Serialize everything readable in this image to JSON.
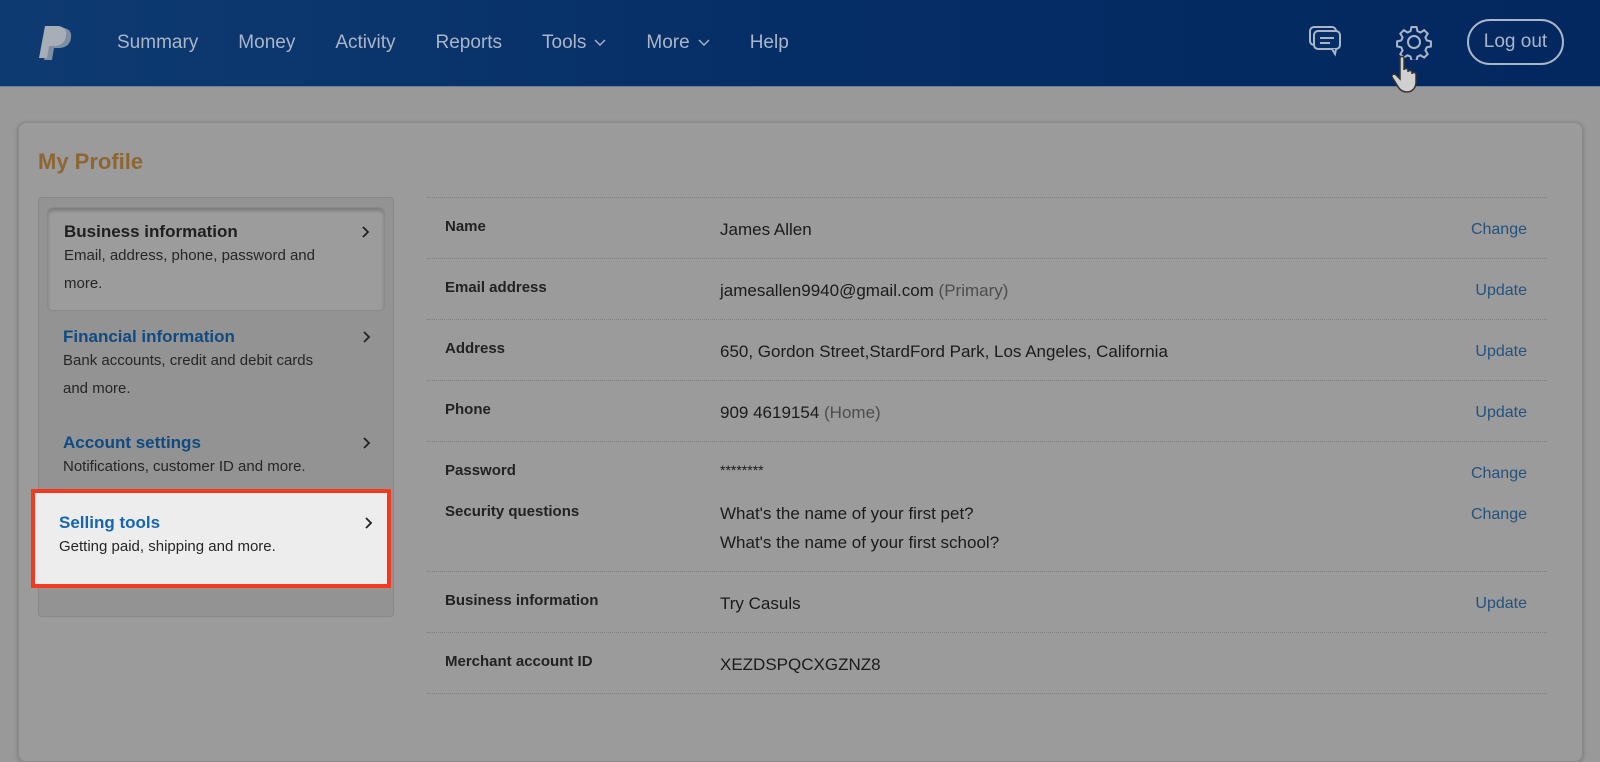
{
  "topbar": {
    "logo": "paypal-logo",
    "nav": [
      {
        "label": "Summary",
        "dropdown": false
      },
      {
        "label": "Money",
        "dropdown": false
      },
      {
        "label": "Activity",
        "dropdown": false
      },
      {
        "label": "Reports",
        "dropdown": false
      },
      {
        "label": "Tools",
        "dropdown": true
      },
      {
        "label": "More",
        "dropdown": true
      },
      {
        "label": "Help",
        "dropdown": false
      }
    ],
    "icons": [
      "messages-icon",
      "gear-icon"
    ],
    "logout_label": "Log out"
  },
  "page": {
    "title": "My Profile"
  },
  "sidebar": {
    "items": [
      {
        "title": "Business information",
        "desc": "Email, address, phone, password and more.",
        "active": true
      },
      {
        "title": "Financial information",
        "desc": "Bank accounts, credit and debit cards and more.",
        "active": false
      },
      {
        "title": "Account settings",
        "desc": "Notifications, customer ID and more.",
        "active": false
      },
      {
        "title": "Selling tools",
        "desc": "Getting paid, shipping and more.",
        "active": false,
        "highlighted": true
      }
    ]
  },
  "details": {
    "rows": [
      {
        "label": "Name",
        "value": "James Allen",
        "note": "",
        "action": "Change"
      },
      {
        "label": "Email address",
        "value": "jamesallen9940@gmail.com",
        "note": "(Primary)",
        "action": "Update"
      },
      {
        "label": "Address",
        "value": "650, Gordon Street,StardFord Park, Los Angeles, California",
        "note": "",
        "action": "Update"
      },
      {
        "label": "Phone",
        "value": "909 4619154",
        "note": "(Home)",
        "action": "Update"
      },
      {
        "label": "Password",
        "value": "********",
        "note": "",
        "action": "Change"
      },
      {
        "label": "Security questions",
        "value": "What's the name of your first pet?",
        "value2": "What's the name of your first school?",
        "note": "",
        "action": "Change"
      },
      {
        "label": "Business information",
        "value": "Try Casuls",
        "note": "",
        "action": "Update"
      },
      {
        "label": "Merchant account ID",
        "value": "XEZDSPQCXGZNZ8",
        "note": "",
        "action": ""
      }
    ]
  },
  "colors": {
    "header_bg": "#062e66",
    "title_accent": "#8d6632",
    "link": "#24527f",
    "highlight": "#f23a22"
  }
}
